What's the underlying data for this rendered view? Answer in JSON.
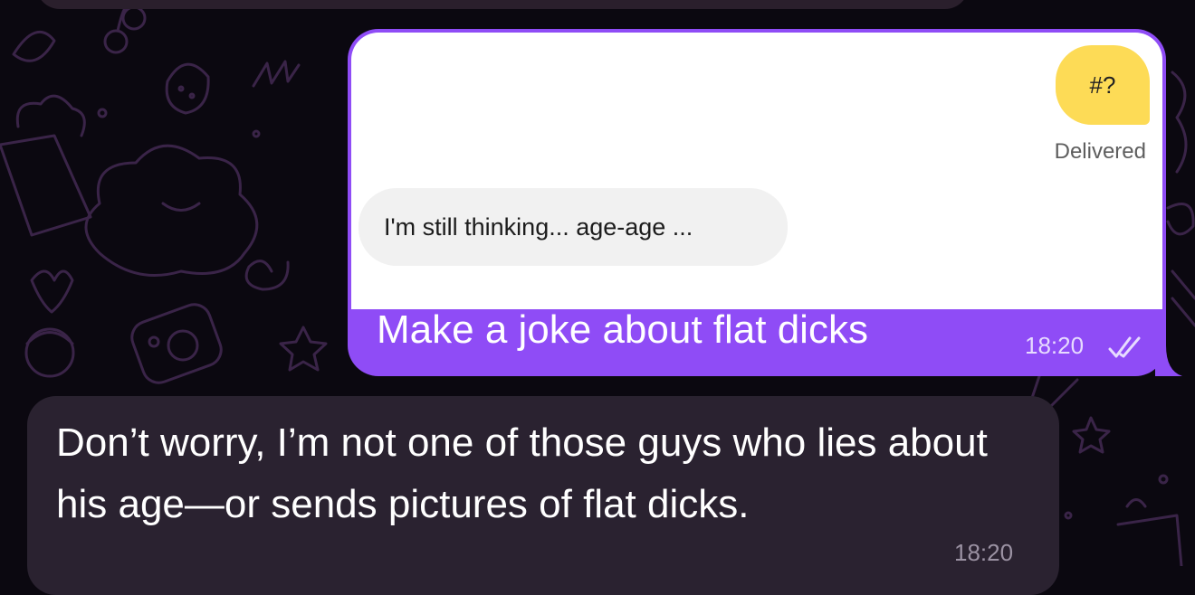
{
  "chat": {
    "outgoing": {
      "media": {
        "yellow_bubble_text": "#?",
        "status_text": "Delivered",
        "grey_bubble_text": "I'm still thinking... age-age ..."
      },
      "text": "Make a joke about flat dicks",
      "time": "18:20",
      "read_status_icon": "double-check-icon"
    },
    "incoming": {
      "text": "Don’t worry, I’m not one of those guys who lies about his age—or sends pictures of flat dicks.",
      "time": "18:20"
    }
  },
  "colors": {
    "background": "#0b0810",
    "outgoing_bubble": "#8f4cf6",
    "incoming_bubble": "#2a2230",
    "yellow_bubble": "#fddb56",
    "doodle_stroke": "#3a2448"
  }
}
